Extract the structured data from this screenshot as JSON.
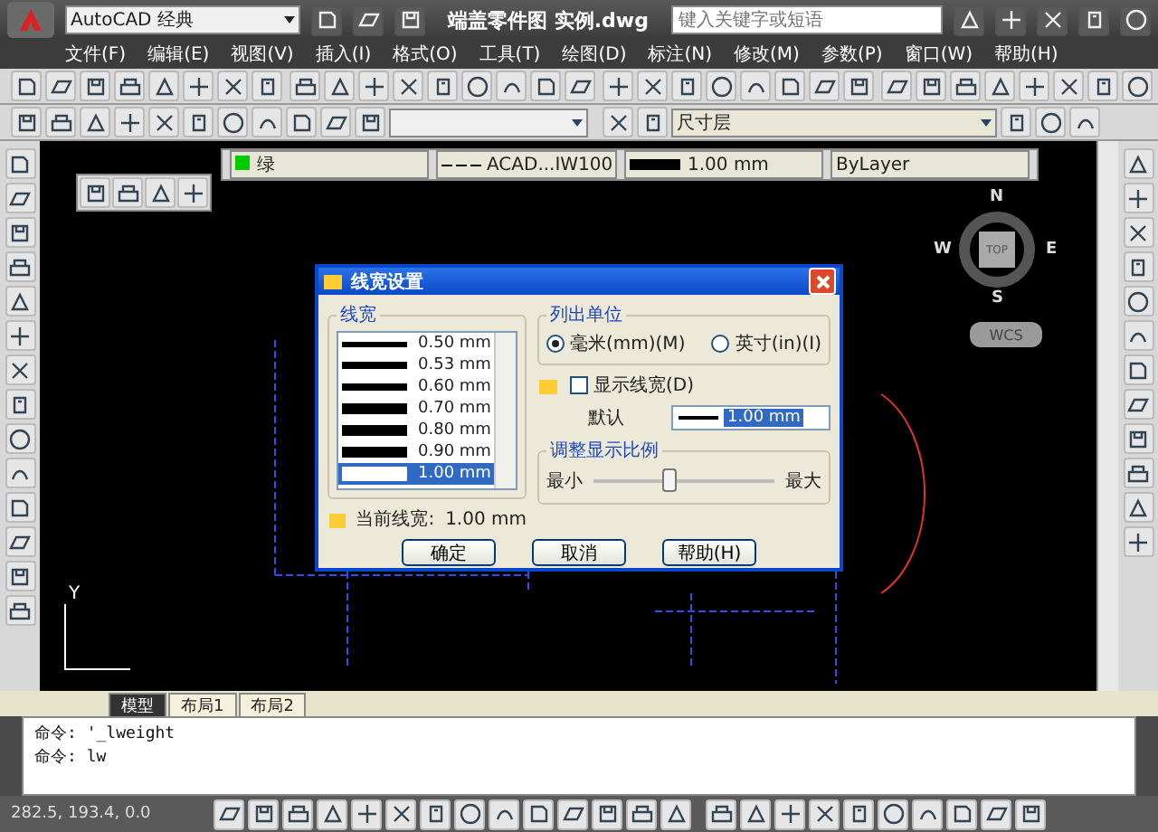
{
  "title_bar": {
    "workspace": "AutoCAD 经典",
    "title": "端盖零件图  实例.dwg",
    "search_placeholder": "键入关键字或短语"
  },
  "menu": [
    "文件(F)",
    "编辑(E)",
    "视图(V)",
    "插入(I)",
    "格式(O)",
    "工具(T)",
    "绘图(D)",
    "标注(N)",
    "修改(M)",
    "参数(P)",
    "窗口(W)",
    "帮助(H)"
  ],
  "layer": {
    "name": "尺寸层"
  },
  "properties": {
    "color_name": "绿",
    "linetype": "ACAD...IW100",
    "lineweight": "1.00 mm",
    "plotstyle": "ByLayer"
  },
  "viewcube": {
    "north": "N",
    "south": "S",
    "east": "E",
    "west": "W",
    "face": "TOP",
    "ucs": "WCS"
  },
  "ucs_icon": {
    "axis": "Y"
  },
  "layout_tabs": [
    {
      "label": "模型",
      "selected": true
    },
    {
      "label": "布局1",
      "selected": false
    },
    {
      "label": "布局2",
      "selected": false
    }
  ],
  "command_lines": [
    "命令: '_lweight",
    "命令: lw"
  ],
  "coordinates": "282.5, 193.4, 0.0",
  "dialog": {
    "title": "线宽设置",
    "list_group": "线宽",
    "lineweights": [
      {
        "label": "0.50 mm",
        "selected": false
      },
      {
        "label": "0.53 mm",
        "selected": false
      },
      {
        "label": "0.60 mm",
        "selected": false
      },
      {
        "label": "0.70 mm",
        "selected": false
      },
      {
        "label": "0.80 mm",
        "selected": false
      },
      {
        "label": "0.90 mm",
        "selected": false
      },
      {
        "label": "1.00 mm",
        "selected": true
      }
    ],
    "units_group": "列出单位",
    "units": [
      {
        "label": "毫米(mm)(M)",
        "selected": true
      },
      {
        "label": "英寸(in)(I)",
        "selected": false
      }
    ],
    "display": {
      "label": "显示线宽(D)",
      "checked": false
    },
    "default_label": "默认",
    "default_value": "1.00 mm",
    "scale_group": "调整显示比例",
    "scale_min": "最小",
    "scale_max": "最大",
    "scale": {
      "level": 0.42
    },
    "current_label": "当前线宽:",
    "current_value": "1.00 mm",
    "buttons": [
      "确定",
      "取消",
      "帮助(H)"
    ]
  }
}
